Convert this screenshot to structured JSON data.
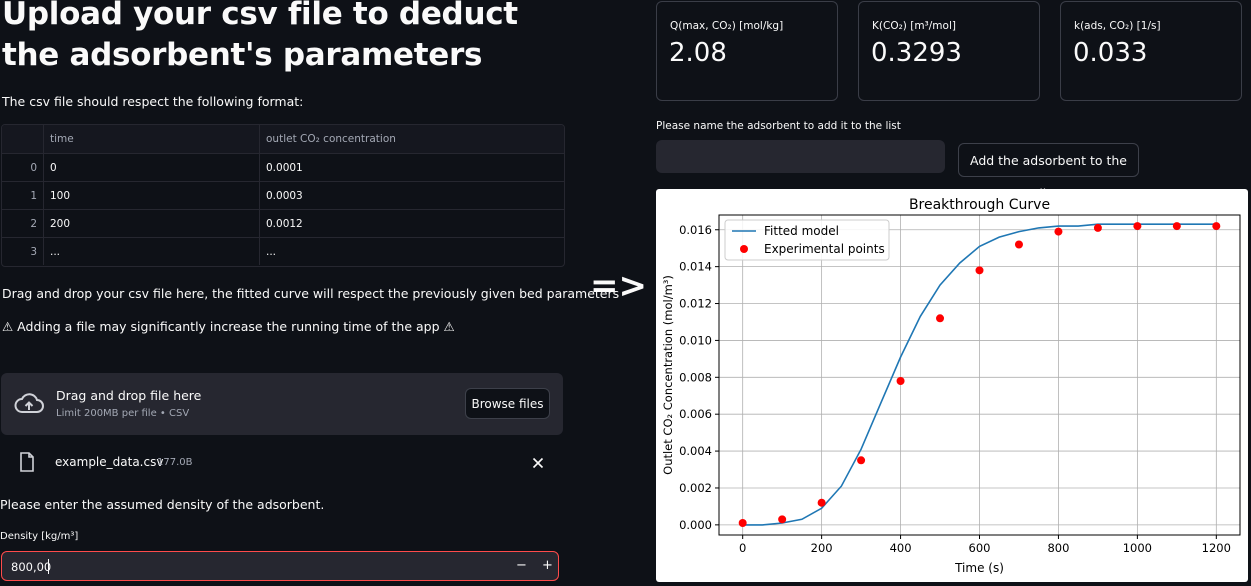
{
  "left": {
    "title": "Upload your csv file to deduct the adsorbent's parameters",
    "format_note": "The csv file should respect the following format:",
    "table": {
      "columns": [
        "time",
        "outlet CO₂ concentration"
      ],
      "rows": [
        {
          "index": "0",
          "time": "0",
          "conc": "0.0001"
        },
        {
          "index": "1",
          "time": "100",
          "conc": "0.0003"
        },
        {
          "index": "2",
          "time": "200",
          "conc": "0.0012"
        },
        {
          "index": "3",
          "time": "...",
          "conc": "..."
        }
      ]
    },
    "drag_note": "Drag and drop your csv file here, the fitted curve will respect the previously given bed parameters",
    "warning": "⚠ Adding a file may significantly increase the running time of the app ⚠",
    "uploader": {
      "title": "Drag and drop file here",
      "limit": "Limit 200MB per file • CSV",
      "browse_label": "Browse files"
    },
    "uploaded_file": {
      "name": "example_data.csv",
      "size": "177.0B"
    },
    "density_prompt": "Please enter the assumed density of the adsorbent.",
    "density_label": "Density [kg/m³]",
    "density_value": "800,00",
    "minus": "−",
    "plus": "+"
  },
  "arrow": "=>",
  "right": {
    "metrics": [
      {
        "label": "Q(max, CO₂) [mol/kg]",
        "value": "2.08"
      },
      {
        "label": "K(CO₂) [m³/mol]",
        "value": "0.3293"
      },
      {
        "label": "k(ads, CO₂) [1/s]",
        "value": "0.033"
      }
    ],
    "name_prompt": "Please name the adsorbent to add it to the list",
    "name_value": "",
    "add_button": "Add the adsorbent to the list"
  },
  "chart_data": {
    "type": "line",
    "title": "Breakthrough Curve",
    "xlabel": "Time (s)",
    "ylabel": "Outlet CO₂ Concentration (mol/m³)",
    "xlim": [
      -60,
      1260
    ],
    "ylim": [
      -0.00055,
      0.0168
    ],
    "x_ticks": [
      0,
      200,
      400,
      600,
      800,
      1000,
      1200
    ],
    "y_ticks": [
      0.0,
      0.002,
      0.004,
      0.006,
      0.008,
      0.01,
      0.012,
      0.014,
      0.016
    ],
    "y_tick_labels": [
      "0.000",
      "0.002",
      "0.004",
      "0.006",
      "0.008",
      "0.010",
      "0.012",
      "0.014",
      "0.016"
    ],
    "grid": true,
    "legend_position": "top-left",
    "series": [
      {
        "name": "Fitted model",
        "kind": "line",
        "color": "#1f77b4",
        "x": [
          0,
          50,
          100,
          150,
          200,
          250,
          300,
          350,
          400,
          450,
          500,
          550,
          600,
          650,
          700,
          750,
          800,
          850,
          900,
          950,
          1000,
          1050,
          1100,
          1150,
          1200
        ],
        "y": [
          0.0,
          0.0,
          0.0001,
          0.0003,
          0.0009,
          0.0021,
          0.0041,
          0.0066,
          0.0091,
          0.0113,
          0.013,
          0.0142,
          0.0151,
          0.0156,
          0.0159,
          0.0161,
          0.0162,
          0.0162,
          0.0163,
          0.0163,
          0.0163,
          0.0163,
          0.0163,
          0.0163,
          0.0163
        ]
      },
      {
        "name": "Experimental points",
        "kind": "scatter",
        "color": "#ff0000",
        "x": [
          0,
          100,
          200,
          300,
          400,
          500,
          600,
          700,
          800,
          900,
          1000,
          1100,
          1200
        ],
        "y": [
          0.0001,
          0.0003,
          0.0012,
          0.0035,
          0.0078,
          0.0112,
          0.0138,
          0.0152,
          0.0159,
          0.0161,
          0.0162,
          0.0162,
          0.0162
        ]
      }
    ]
  }
}
